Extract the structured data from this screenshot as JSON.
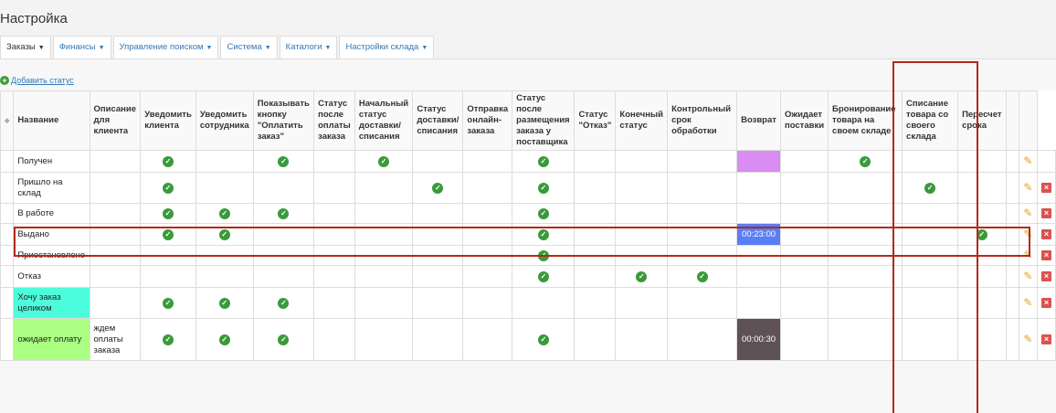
{
  "page": {
    "title": "Настройка"
  },
  "tabs": [
    {
      "label": "Заказы",
      "active": true
    },
    {
      "label": "Финансы",
      "active": false
    },
    {
      "label": "Управление поиском",
      "active": false
    },
    {
      "label": "Система",
      "active": false
    },
    {
      "label": "Каталоги",
      "active": false
    },
    {
      "label": "Настройки склада",
      "active": false
    }
  ],
  "add_status": {
    "label": "Добавить статус"
  },
  "columns": [
    "Название",
    "Описание для клиента",
    "Уведомить клиента",
    "Уведомить сотрудника",
    "Показывать кнопку \"Оплатить заказ\"",
    "Статус после оплаты заказа",
    "Начальный статус доставки/ списания",
    "Статус доставки/ списания",
    "Отправка онлайн-заказа",
    "Статус после размещения заказа у поставщика",
    "Статус \"Отказ\"",
    "Конечный статус",
    "Контрольный срок обработки",
    "Возврат",
    "Ожидает поставки",
    "Бронирование товара на своем складе",
    "Списание товара со своего склада",
    "Пересчет срока"
  ],
  "rows": [
    {
      "name": "Получен",
      "description": "",
      "color": "",
      "checks": [
        1,
        0,
        1,
        0,
        1,
        0,
        0,
        1,
        0,
        0,
        0
      ],
      "deadline": "",
      "deadline_color": "#d98cf2",
      "checks2": [
        0,
        1,
        0,
        0,
        0
      ]
    },
    {
      "name": "Пришло на склад",
      "description": "",
      "color": "",
      "checks": [
        1,
        0,
        0,
        0,
        0,
        1,
        0,
        1,
        0,
        0,
        0
      ],
      "deadline": "",
      "deadline_color": "",
      "checks2": [
        0,
        0,
        1,
        0,
        0
      ]
    },
    {
      "name": "В работе",
      "description": "",
      "color": "",
      "checks": [
        1,
        1,
        1,
        0,
        0,
        0,
        0,
        1,
        0,
        0,
        0
      ],
      "deadline": "",
      "deadline_color": "",
      "checks2": [
        0,
        0,
        0,
        0,
        0
      ]
    },
    {
      "name": "Выдано",
      "description": "",
      "color": "",
      "checks": [
        1,
        1,
        0,
        0,
        0,
        0,
        0,
        1,
        0,
        0,
        0
      ],
      "deadline": "00:23:00",
      "deadline_color": "#5a7ef5",
      "checks2": [
        0,
        0,
        0,
        1,
        0
      ]
    },
    {
      "name": "Приостановлено",
      "description": "",
      "color": "",
      "checks": [
        0,
        0,
        0,
        0,
        0,
        0,
        0,
        1,
        0,
        0,
        0
      ],
      "deadline": "",
      "deadline_color": "",
      "checks2": [
        0,
        0,
        0,
        0,
        0
      ]
    },
    {
      "name": "Отказ",
      "description": "",
      "color": "",
      "checks": [
        0,
        0,
        0,
        0,
        0,
        0,
        0,
        1,
        0,
        1,
        1
      ],
      "deadline": "",
      "deadline_color": "",
      "checks2": [
        0,
        0,
        0,
        0,
        0
      ]
    },
    {
      "name": "Хочу заказ целиком",
      "description": "",
      "color": "#4dfcdc",
      "checks": [
        1,
        1,
        1,
        0,
        0,
        0,
        0,
        0,
        0,
        0,
        0
      ],
      "deadline": "",
      "deadline_color": "",
      "checks2": [
        0,
        0,
        0,
        0,
        0
      ]
    },
    {
      "name": "ожидает оплату",
      "description": "ждем оплаты заказа",
      "color": "#aaff82",
      "checks": [
        1,
        1,
        1,
        0,
        0,
        0,
        0,
        1,
        0,
        0,
        0
      ],
      "deadline": "00:00:30",
      "deadline_color": "#5f5257",
      "checks2": [
        0,
        0,
        0,
        0,
        0
      ]
    }
  ],
  "colors": {
    "highlight": "#b22a1a",
    "check": "#3a9a3a",
    "link": "#337ab7"
  }
}
